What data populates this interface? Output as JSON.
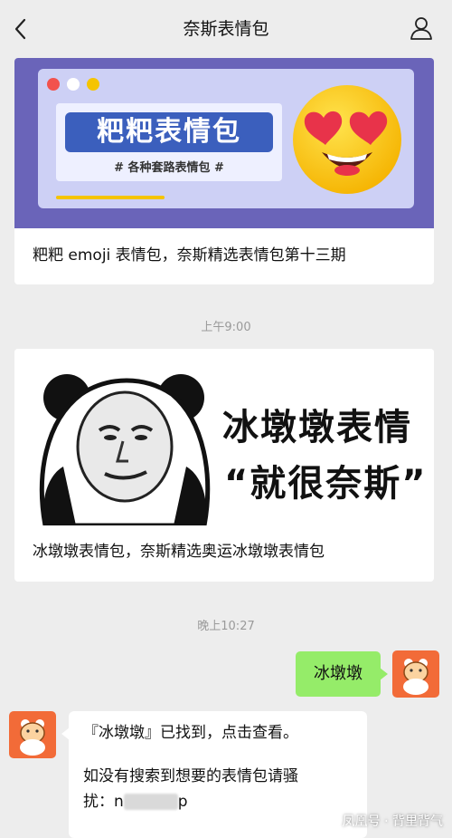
{
  "header": {
    "title": "奈斯表情包"
  },
  "icons": {
    "back": "chevron-left-icon",
    "profile": "user-icon"
  },
  "articles": [
    {
      "banner_title": "粑粑表情包",
      "banner_subtitle": "# 各种套路表情包 #",
      "caption": "粑粑 emoji 表情包，奈斯精选表情包第十三期"
    },
    {
      "banner_title_line1": "冰墩墩表情",
      "banner_title_line2": "“就很奈斯”",
      "caption": "冰墩墩表情包，奈斯精选奥运冰墩墩表情包"
    }
  ],
  "timestamps": {
    "first": "上午9:00",
    "second": "晚上10:27"
  },
  "messages": {
    "sent": "冰墩墩",
    "reply_line1": "『冰墩墩』已找到，点击查看。",
    "reply_line2": "如没有搜索到想要的表情包请骚",
    "reply_line3_prefix": "扰：n",
    "reply_line3_suffix": "p"
  },
  "watermark": "凤凰号 · 背里背气",
  "colors": {
    "background": "#ededed",
    "sent_bubble": "#95ec69",
    "banner_purple": "#6a64b9",
    "avatar_orange": "#f26b38"
  }
}
